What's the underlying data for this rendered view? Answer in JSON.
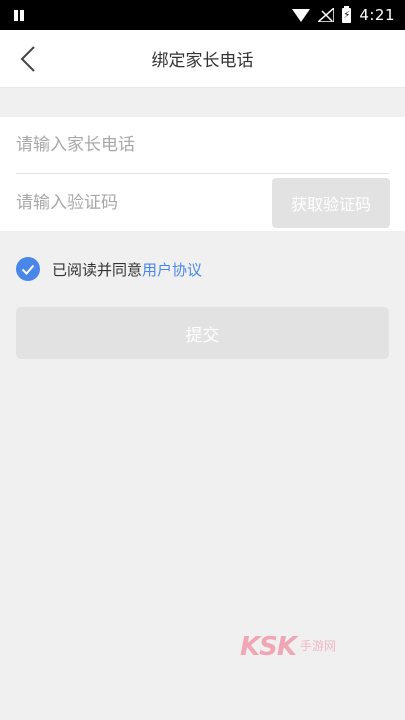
{
  "status_bar": {
    "time": "4:21",
    "battery_glyph": "⚡",
    "icons": [
      "sim-card-icon",
      "wifi-icon",
      "no-signal-icon",
      "battery-charging-icon"
    ]
  },
  "nav": {
    "title": "绑定家长电话",
    "back_icon": "chevron-left-icon"
  },
  "form": {
    "phone_placeholder": "请输入家长电话",
    "phone_value": "",
    "code_placeholder": "请输入验证码",
    "code_value": "",
    "get_code_label": "获取验证码"
  },
  "agreement": {
    "checked": true,
    "text": "已阅读并同意",
    "link_label": "用户协议"
  },
  "submit_label": "提交",
  "watermark": {
    "logo": "KSK",
    "text": "手游网"
  },
  "colors": {
    "accent": "#4a86e8",
    "disabled_button": "#e2e2e2",
    "page_background": "#f0f0f0"
  }
}
